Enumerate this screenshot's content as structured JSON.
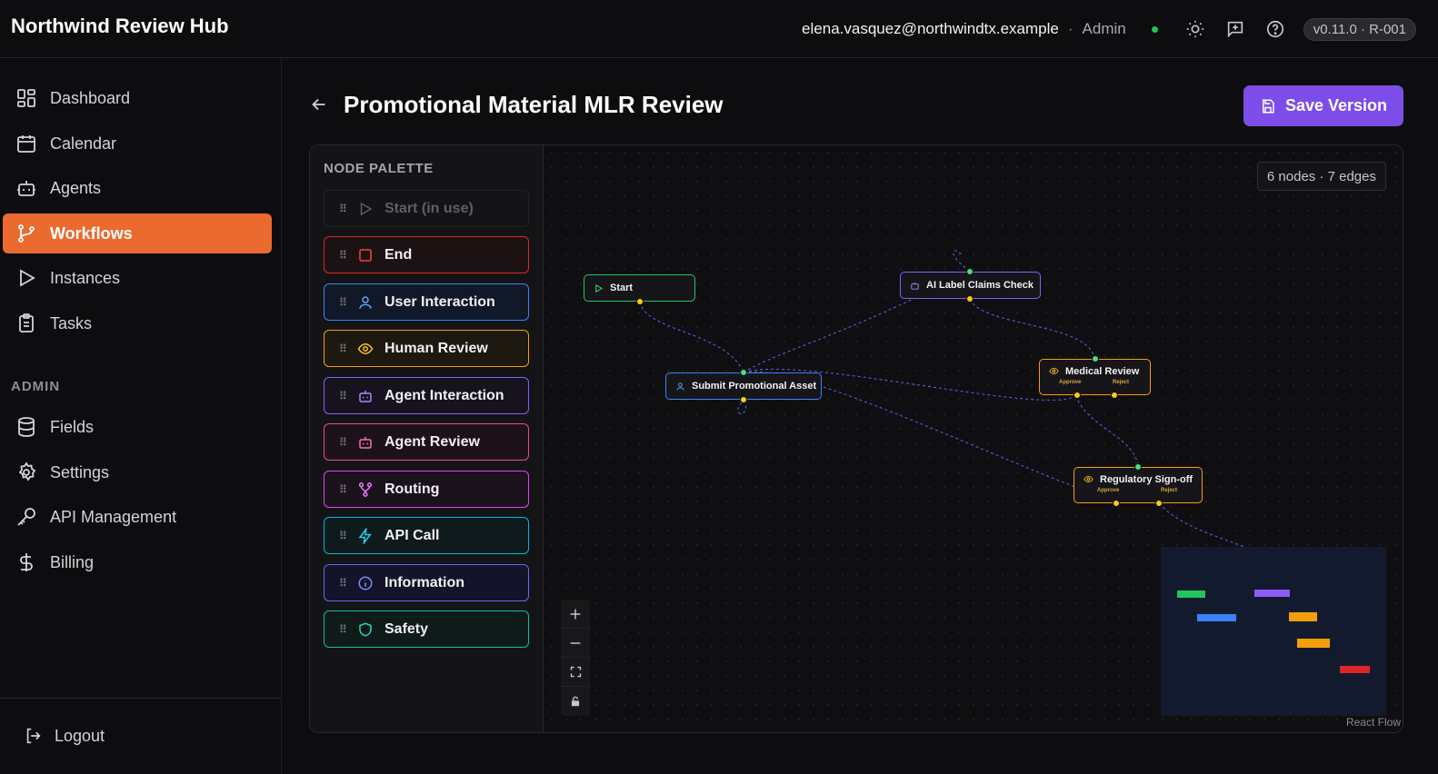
{
  "app": {
    "title": "Northwind Review Hub"
  },
  "user": {
    "email": "elena.vasquez@northwindtx.example",
    "separator": "·",
    "role": "Admin",
    "version": "v0.11.0 · R-001"
  },
  "nav": {
    "items": [
      {
        "label": "Dashboard",
        "icon": "dashboard-icon"
      },
      {
        "label": "Calendar",
        "icon": "calendar-icon"
      },
      {
        "label": "Agents",
        "icon": "bot-icon"
      },
      {
        "label": "Workflows",
        "icon": "workflow-icon",
        "active": true
      },
      {
        "label": "Instances",
        "icon": "play-icon"
      },
      {
        "label": "Tasks",
        "icon": "clipboard-icon"
      }
    ],
    "admin_label": "ADMIN",
    "admin_items": [
      {
        "label": "Fields",
        "icon": "database-icon"
      },
      {
        "label": "Settings",
        "icon": "gear-icon"
      },
      {
        "label": "API Management",
        "icon": "key-icon"
      },
      {
        "label": "Billing",
        "icon": "dollar-icon"
      }
    ],
    "logout": "Logout"
  },
  "page": {
    "title": "Promotional Material MLR Review",
    "save_label": "Save Version"
  },
  "palette": {
    "title": "NODE PALETTE",
    "items": [
      {
        "label": "Start (in use)",
        "color": "#3a3a3f",
        "disabled": true
      },
      {
        "label": "End",
        "color": "#dc2626"
      },
      {
        "label": "User Interaction",
        "color": "#3b82f6"
      },
      {
        "label": "Human Review",
        "color": "#f59e0b"
      },
      {
        "label": "Agent Interaction",
        "color": "#8b5cf6"
      },
      {
        "label": "Agent Review",
        "color": "#ec4899"
      },
      {
        "label": "Routing",
        "color": "#d946ef"
      },
      {
        "label": "API Call",
        "color": "#06b6d4"
      },
      {
        "label": "Information",
        "color": "#6366f1"
      },
      {
        "label": "Safety",
        "color": "#14b8a6"
      }
    ]
  },
  "canvas": {
    "stats": "6 nodes · 7 edges",
    "nodes": [
      {
        "label": "Start",
        "color": "#22c55e"
      },
      {
        "label": "AI Label Claims Check",
        "color": "#8b5cf6"
      },
      {
        "label": "Submit Promotional Asset",
        "color": "#3b82f6"
      },
      {
        "label": "Medical Review",
        "color": "#f59e0b",
        "approve": "Approve",
        "reject": "Reject"
      },
      {
        "label": "Regulatory Sign-off",
        "color": "#f59e0b",
        "approve": "Approve",
        "reject": "Reject"
      }
    ],
    "attribution": "React Flow"
  }
}
